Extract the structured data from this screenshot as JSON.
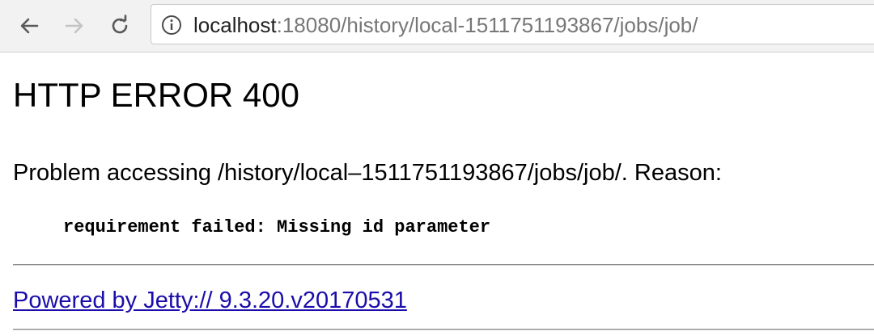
{
  "browser": {
    "back_icon": "arrow-left-icon",
    "forward_icon": "arrow-right-icon",
    "reload_icon": "reload-icon",
    "info_icon": "info-circle-icon",
    "url_host": "localhost",
    "url_rest": ":18080/history/local-1511751193867/jobs/job/"
  },
  "page": {
    "heading": "HTTP ERROR 400",
    "problem_text": "Problem accessing /history/local–1511751193867/jobs/job/. Reason:",
    "reason": "requirement failed: Missing id parameter",
    "footer_link": "Powered by Jetty:// 9.3.20.v20170531"
  }
}
